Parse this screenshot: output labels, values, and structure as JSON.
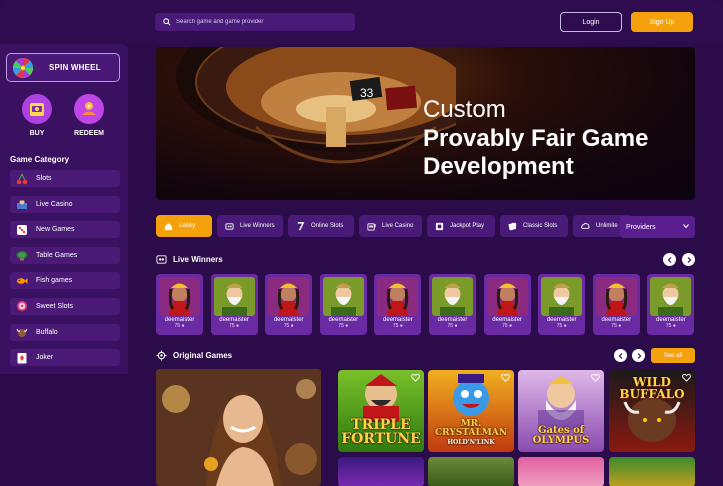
{
  "header": {
    "search_placeholder": "Search game and game provider",
    "login_label": "Login",
    "signup_label": "Sign Up"
  },
  "sidebar": {
    "spin_wheel_label": "SPIN WHEEL",
    "buy_label": "BUY",
    "redeem_label": "REDEEM",
    "category_title": "Game Category",
    "categories": [
      {
        "label": "Slots",
        "icon": "cherry-icon"
      },
      {
        "label": "Live Casino",
        "icon": "dealer-icon"
      },
      {
        "label": "New Games",
        "icon": "dice-icon"
      },
      {
        "label": "Table Games",
        "icon": "table-icon"
      },
      {
        "label": "Fish games",
        "icon": "fish-icon"
      },
      {
        "label": "Sweet Slots",
        "icon": "candy-icon"
      },
      {
        "label": "Buffalo",
        "icon": "buffalo-icon"
      },
      {
        "label": "Joker",
        "icon": "joker-icon"
      }
    ]
  },
  "banner": {
    "line1": "Custom",
    "line2": "Provably Fair Game Development",
    "roulette_number": "33"
  },
  "tabs": [
    {
      "label": "Lobby",
      "active": true,
      "icon": "home-icon"
    },
    {
      "label": "Live Winners",
      "active": false,
      "icon": "winners-icon"
    },
    {
      "label": "Online Slots",
      "active": false,
      "icon": "seven-icon"
    },
    {
      "label": "Live Casino",
      "active": false,
      "icon": "slot-machine-icon"
    },
    {
      "label": "Jackpot Play",
      "active": false,
      "icon": "jackpot-icon"
    },
    {
      "label": "Classic Slots",
      "active": false,
      "icon": "cards-icon"
    },
    {
      "label": "Unlimite",
      "active": false,
      "icon": "cloud-icon"
    }
  ],
  "providers_label": "Providers",
  "live_winners": {
    "title": "Live Winners",
    "items": [
      {
        "name": "deemaister",
        "amount": "75",
        "avatar": "queen"
      },
      {
        "name": "deemaister",
        "amount": "75",
        "avatar": "gnome"
      },
      {
        "name": "deemaister",
        "amount": "75",
        "avatar": "queen"
      },
      {
        "name": "deemaister",
        "amount": "75",
        "avatar": "gnome"
      },
      {
        "name": "deemaister",
        "amount": "75",
        "avatar": "queen"
      },
      {
        "name": "deemaister",
        "amount": "75",
        "avatar": "gnome"
      },
      {
        "name": "deemaister",
        "amount": "75",
        "avatar": "queen"
      },
      {
        "name": "deemaister",
        "amount": "75",
        "avatar": "gnome"
      },
      {
        "name": "deemaister",
        "amount": "75",
        "avatar": "queen"
      },
      {
        "name": "deemaister",
        "amount": "75",
        "avatar": "gnome"
      }
    ]
  },
  "original_games": {
    "title": "Original Games",
    "see_all_label": "See all",
    "games": [
      {
        "title": "TRIPLE FORTUNE"
      },
      {
        "title": "MR. CRYSTALMAN"
      },
      {
        "title": "Gates of OLYMPUS"
      },
      {
        "title": "WILD BUFFALO"
      }
    ],
    "game_subtitles": {
      "mr_crystalman": "HOLD'N'LINK"
    }
  },
  "colors": {
    "accent": "#f5a10b",
    "background": "#2b0b4a",
    "sidebar": "#3a1160",
    "pill": "#4a1a78"
  }
}
